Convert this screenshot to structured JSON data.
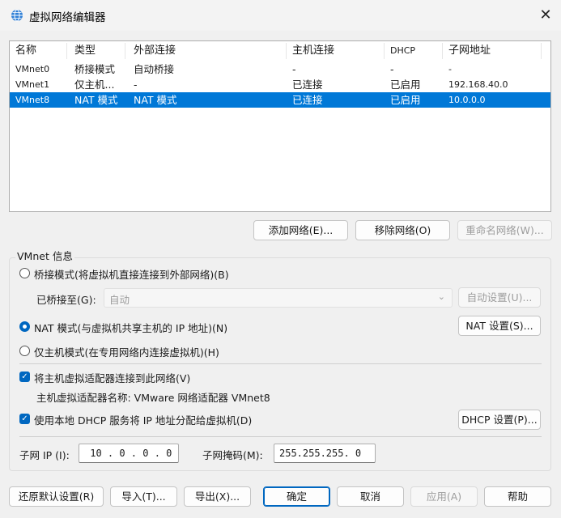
{
  "window": {
    "title": "虚拟网络编辑器",
    "close_glyph": "✕",
    "icon": "network-globe-icon"
  },
  "table": {
    "columns": [
      "名称",
      "类型",
      "外部连接",
      "主机连接",
      "DHCP",
      "子网地址"
    ],
    "rows": [
      {
        "name": "VMnet0",
        "type": "桥接模式",
        "external": "自动桥接",
        "host": "-",
        "dhcp": "-",
        "subnet": "-",
        "selected": false
      },
      {
        "name": "VMnet1",
        "type": "仅主机...",
        "external": "-",
        "host": "已连接",
        "dhcp": "已启用",
        "subnet": "192.168.40.0",
        "selected": false
      },
      {
        "name": "VMnet8",
        "type": "NAT 模式",
        "external": "NAT 模式",
        "host": "已连接",
        "dhcp": "已启用",
        "subnet": "10.0.0.0",
        "selected": true
      }
    ]
  },
  "list_buttons": {
    "add": "添加网络(E)...",
    "remove": "移除网络(O)",
    "rename": "重命名网络(W)..."
  },
  "vmnet_info": {
    "group_title": "VMnet 信息",
    "bridged_label": "桥接模式(将虚拟机直接连接到外部网络)(B)",
    "bridged_to_label": "已桥接至(G):",
    "bridged_to_value": "自动",
    "auto_settings": "自动设置(U)...",
    "nat_label": "NAT 模式(与虚拟机共享主机的 IP 地址)(N)",
    "nat_settings": "NAT 设置(S)...",
    "hostonly_label": "仅主机模式(在专用网络内连接虚拟机)(H)",
    "selected_mode": "nat",
    "connect_adapter_label": "将主机虚拟适配器连接到此网络(V)",
    "connect_adapter_checked": true,
    "adapter_name_text": "主机虚拟适配器名称: VMware 网络适配器 VMnet8",
    "dhcp_label": "使用本地 DHCP 服务将 IP 地址分配给虚拟机(D)",
    "dhcp_checked": true,
    "dhcp_settings": "DHCP 设置(P)...",
    "subnet_ip_label": "子网 IP (I):",
    "subnet_ip_value": " 10 . 0 . 0 . 0",
    "subnet_mask_label": "子网掩码(M):",
    "subnet_mask_value": "255.255.255. 0"
  },
  "footer": {
    "restore_defaults": "还原默认设置(R)",
    "import": "导入(T)...",
    "export": "导出(X)...",
    "ok": "确定",
    "cancel": "取消",
    "apply": "应用(A)",
    "help": "帮助"
  },
  "colors": {
    "selection": "#0078d7",
    "accent": "#0067c0",
    "background": "#f0f0f0"
  }
}
